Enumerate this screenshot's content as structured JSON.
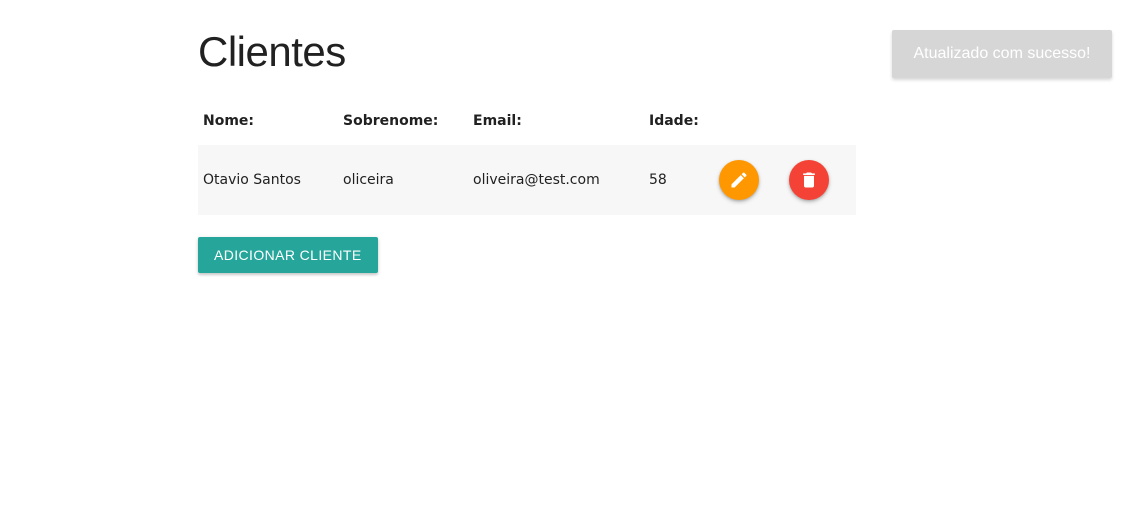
{
  "page": {
    "title": "Clientes"
  },
  "table": {
    "headers": {
      "nome": "Nome:",
      "sobrenome": "Sobrenome:",
      "email": "Email:",
      "idade": "Idade:"
    },
    "rows": [
      {
        "nome": "Otavio Santos",
        "sobrenome": "oliceira",
        "email": "oliveira@test.com",
        "idade": "58",
        "edit_icon": "pencil-icon",
        "delete_icon": "trash-icon"
      }
    ]
  },
  "actions": {
    "add_label": "ADICIONAR CLIENTE"
  },
  "toast": {
    "message": "Atualizado com sucesso!"
  },
  "colors": {
    "accent": "#26a69a",
    "edit": "#ff9800",
    "delete": "#f44336",
    "toast_bg": "#d6d6d6",
    "row_bg": "#f7f7f7"
  }
}
